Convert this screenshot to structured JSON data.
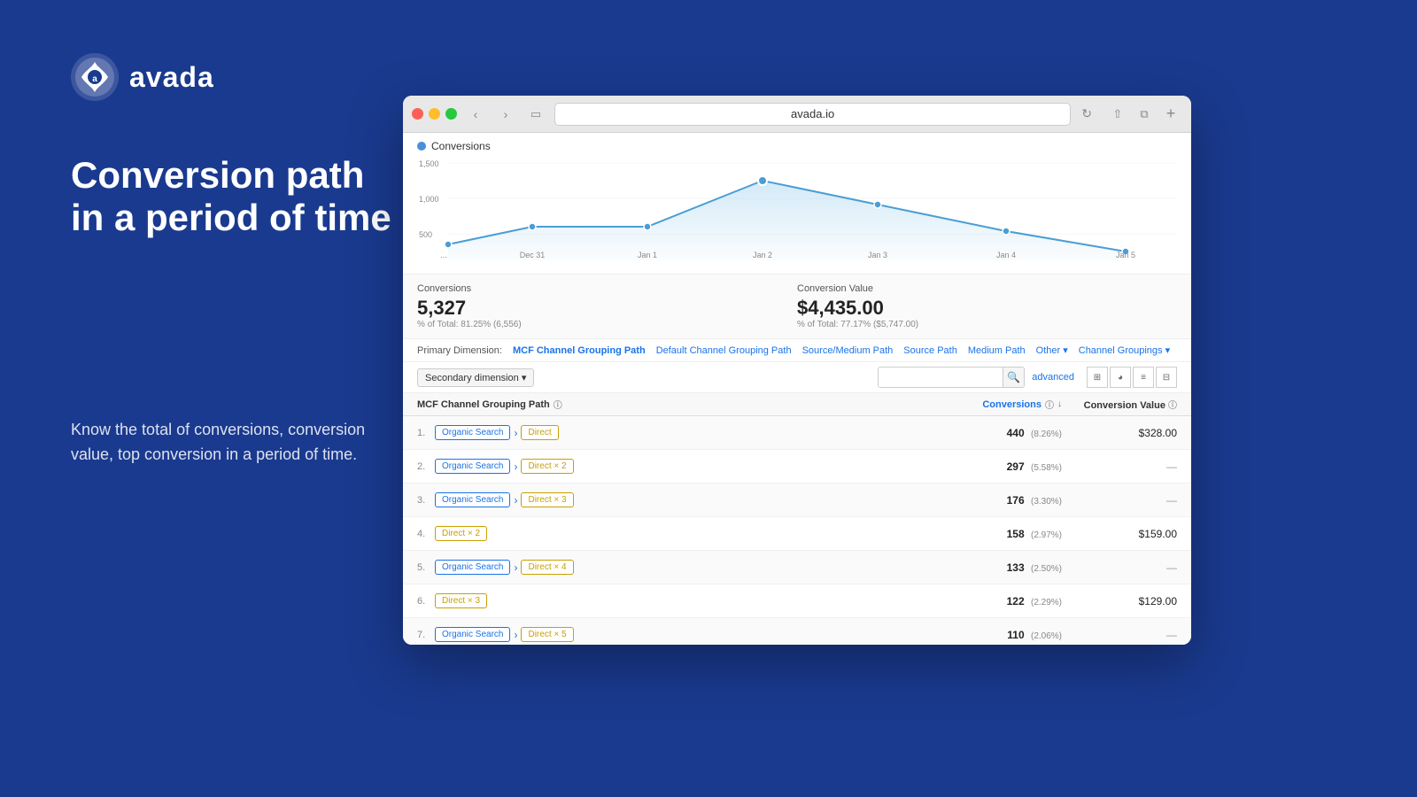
{
  "background_color": "#1a3a8f",
  "logo": {
    "text": "avada"
  },
  "headline": "Conversion path in a period of time",
  "description": "Know the total of conversions, conversion value, top conversion in a period of time.",
  "browser": {
    "url": "avada.io",
    "chart": {
      "legend": "Conversions",
      "y_labels": [
        "1,500",
        "1,000",
        "500"
      ],
      "x_labels": [
        "...",
        "Dec 31",
        "Jan 1",
        "Jan 2",
        "Jan 3",
        "Jan 4",
        "Jan 5"
      ]
    },
    "stats": {
      "conversions_label": "Conversions",
      "conversions_value": "5,327",
      "conversions_sub": "% of Total: 81.25% (6,556)",
      "conv_value_label": "Conversion Value",
      "conv_value": "$4,435.00",
      "conv_value_sub": "% of Total: 77.17% ($5,747.00)"
    },
    "dimension_tabs": {
      "prefix": "Primary Dimension:  MCF Channel Grouping Path",
      "tabs": [
        "Default Channel Grouping Path",
        "Source/Medium Path",
        "Source Path",
        "Medium Path",
        "Other ▾",
        "Channel Groupings ▾"
      ]
    },
    "toolbar": {
      "secondary_dim": "Secondary dimension ▾",
      "advanced_link": "advanced",
      "search_placeholder": ""
    },
    "table": {
      "header": {
        "path_label": "MCF Channel Grouping Path",
        "conversions_label": "Conversions",
        "conv_value_label": "Conversion Value"
      },
      "rows": [
        {
          "num": "1.",
          "tags": [
            {
              "label": "Organic Search",
              "type": "organic"
            },
            {
              "label": "Direct",
              "type": "direct"
            }
          ],
          "conversions": "440",
          "pct": "(8.26%)",
          "value": "$328.00"
        },
        {
          "num": "2.",
          "tags": [
            {
              "label": "Organic Search",
              "type": "organic"
            },
            {
              "label": "Direct × 2",
              "type": "direct"
            }
          ],
          "conversions": "297",
          "pct": "(5.58%)",
          "value": "—"
        },
        {
          "num": "3.",
          "tags": [
            {
              "label": "Organic Search",
              "type": "organic"
            },
            {
              "label": "Direct × 3",
              "type": "direct"
            }
          ],
          "conversions": "176",
          "pct": "(3.30%)",
          "value": "—"
        },
        {
          "num": "4.",
          "tags": [
            {
              "label": "Direct × 2",
              "type": "direct"
            }
          ],
          "conversions": "158",
          "pct": "(2.97%)",
          "value": "$159.00"
        },
        {
          "num": "5.",
          "tags": [
            {
              "label": "Organic Search",
              "type": "organic"
            },
            {
              "label": "Direct × 4",
              "type": "direct"
            }
          ],
          "conversions": "133",
          "pct": "(2.50%)",
          "value": "—"
        },
        {
          "num": "6.",
          "tags": [
            {
              "label": "Direct × 3",
              "type": "direct"
            }
          ],
          "conversions": "122",
          "pct": "(2.29%)",
          "value": "$129.00"
        },
        {
          "num": "7.",
          "tags": [
            {
              "label": "Organic Search",
              "type": "organic"
            },
            {
              "label": "Direct × 5",
              "type": "direct"
            }
          ],
          "conversions": "110",
          "pct": "(2.06%)",
          "value": "—"
        }
      ]
    }
  }
}
